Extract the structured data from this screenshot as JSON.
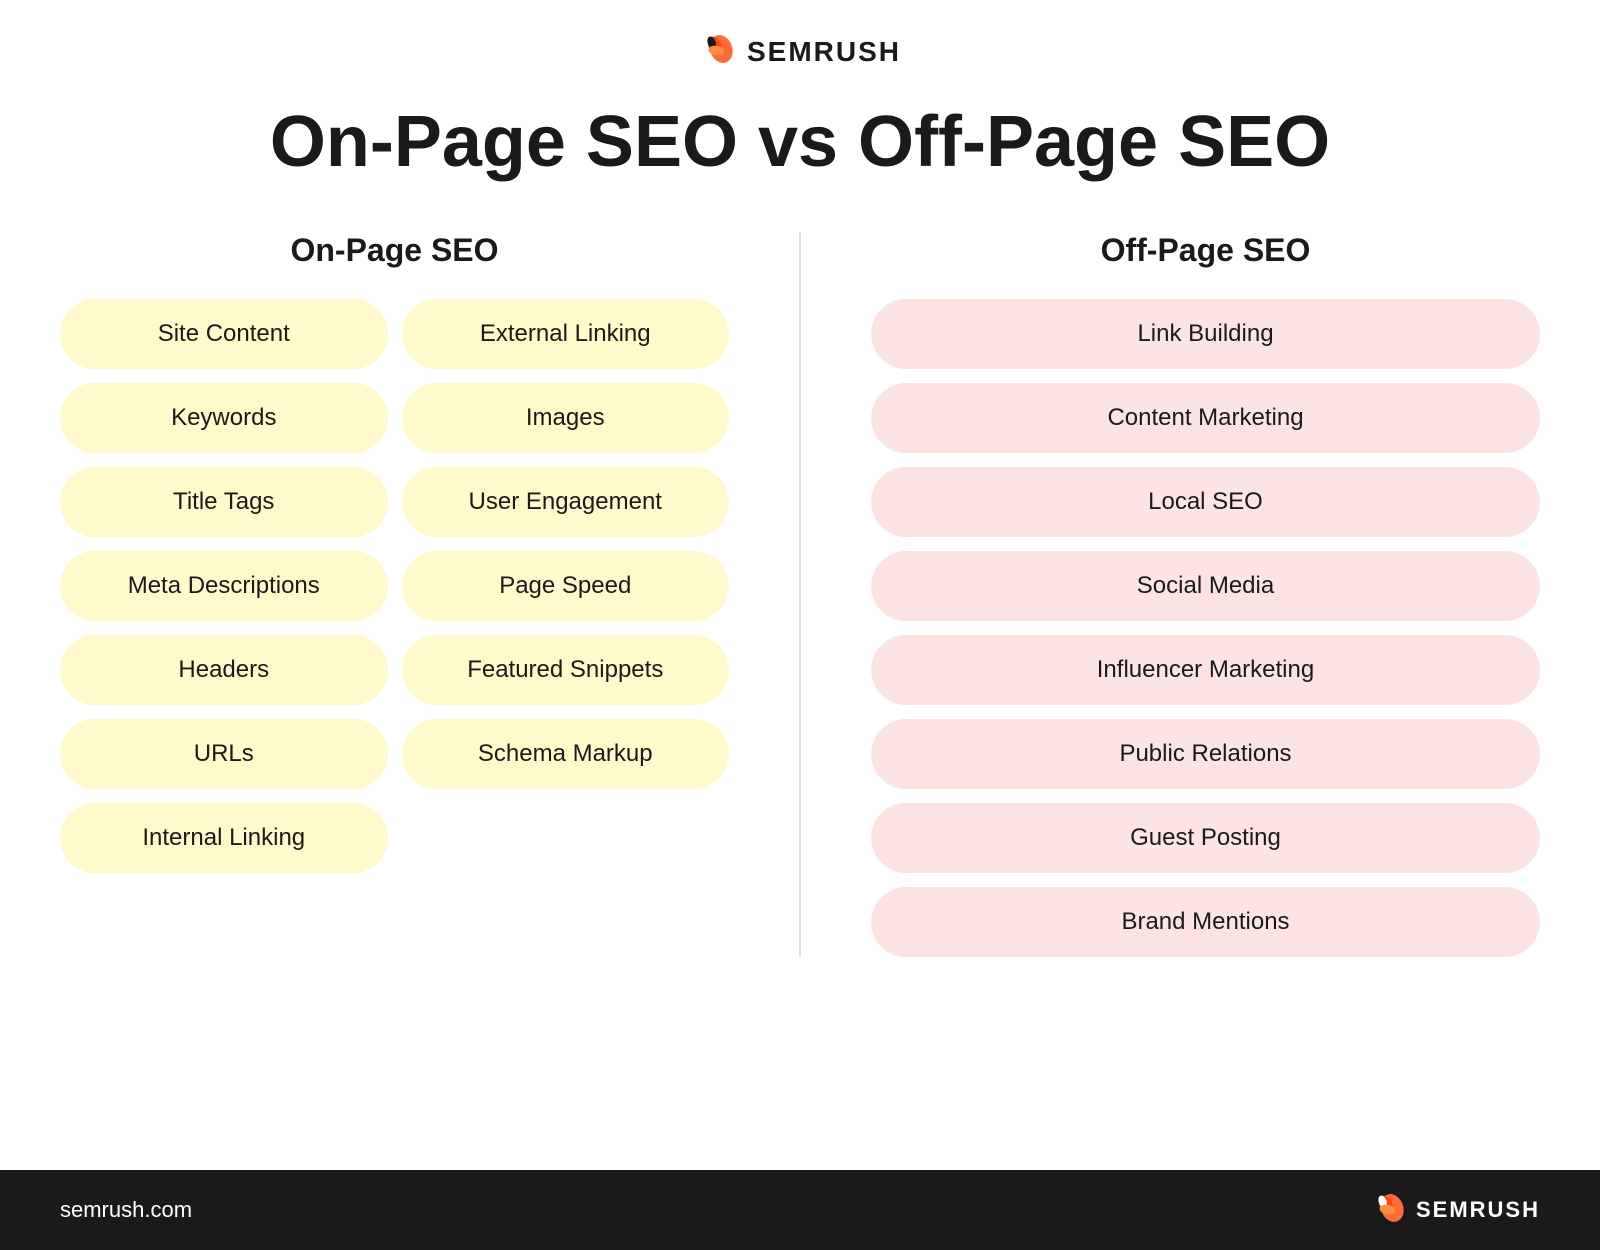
{
  "header": {
    "logo_text": "SEMRUSH",
    "title": "On-Page SEO vs Off-Page SEO"
  },
  "onpage": {
    "column_title": "On-Page SEO",
    "left_items": [
      "Site Content",
      "Keywords",
      "Title Tags",
      "Meta Descriptions",
      "Headers",
      "URLs",
      "Internal Linking"
    ],
    "right_items": [
      "External Linking",
      "Images",
      "User Engagement",
      "Page Speed",
      "Featured Snippets",
      "Schema Markup"
    ]
  },
  "offpage": {
    "column_title": "Off-Page SEO",
    "items": [
      "Link Building",
      "Content Marketing",
      "Local SEO",
      "Social Media",
      "Influencer Marketing",
      "Public Relations",
      "Guest Posting",
      "Brand Mentions"
    ]
  },
  "footer": {
    "url": "semrush.com",
    "logo_text": "SEMRUSH"
  }
}
